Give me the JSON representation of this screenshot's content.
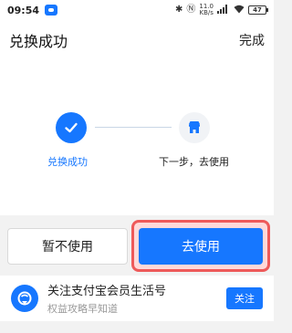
{
  "status_bar": {
    "time": "09:54",
    "network_speed": "11.0\nKB/s",
    "battery_level": "47",
    "icons": [
      "app-icon",
      "bluetooth-icon",
      "nfc-icon",
      "signal-icon",
      "wifi-icon",
      "battery-icon"
    ]
  },
  "header": {
    "title": "兑换成功",
    "done_label": "完成"
  },
  "steps": [
    {
      "label": "兑换成功",
      "icon": "check-icon",
      "status": "done",
      "color": "#1677ff"
    },
    {
      "label": "下一步，去使用",
      "icon": "store-icon",
      "status": "pending",
      "color": "#1677ff"
    }
  ],
  "buttons": {
    "later_label": "暂不使用",
    "use_label": "去使用"
  },
  "follow_card": {
    "title": "关注支付宝会员生活号",
    "subtitle": "权益攻略早知道",
    "follow_label": "关注",
    "avatar_icon": "member-badge-icon"
  },
  "colors": {
    "accent": "#1677ff",
    "highlight": "#ee5a5a"
  }
}
